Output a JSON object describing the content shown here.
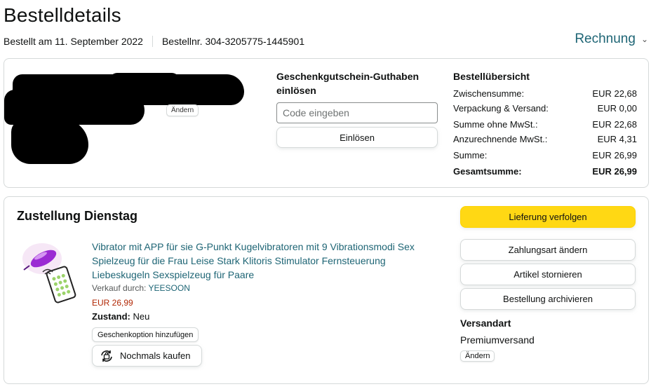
{
  "page": {
    "title": "Bestelldetails",
    "order_date": "Bestellt am 11. September 2022",
    "order_number": "Bestellnr. 304-3205775-1445901",
    "invoice_label": "Rechnung"
  },
  "address_section": {
    "change_label": "Ändern"
  },
  "gift_card": {
    "title": "Geschenkgutschein-Guthaben einlösen",
    "placeholder": "Code eingeben",
    "redeem_label": "Einlösen"
  },
  "summary": {
    "title": "Bestellübersicht",
    "rows": [
      {
        "label": "Zwischensumme:",
        "value": "EUR 22,68"
      },
      {
        "label": "Verpackung & Versand:",
        "value": "EUR 0,00"
      },
      {
        "label": "Summe ohne MwSt.:",
        "value": "EUR 22,68"
      },
      {
        "label": "Anzurechnende MwSt.:",
        "value": "EUR 4,31"
      },
      {
        "label": "Summe:",
        "value": "EUR 26,99"
      }
    ],
    "total_label": "Gesamtsumme:",
    "total_value": "EUR 26,99"
  },
  "delivery": {
    "title": "Zustellung Dienstag",
    "product": {
      "title": "Vibrator mit APP für sie G-Punkt Kugelvibratoren mit 9 Vibrationsmodi Sex Spielzeug für die Frau Leise Stark Klitoris Stimulator Fernsteuerung Liebeskugeln Sexspielzeug für Paare",
      "seller_prefix": "Verkauf durch:",
      "seller_name": "YEESOON",
      "price": "EUR 26,99",
      "condition_label": "Zustand:",
      "condition_value": "Neu",
      "gift_option_label": "Geschenkoption hinzufügen",
      "buy_again_label": "Nochmals kaufen"
    },
    "actions": {
      "track": "Lieferung verfolgen",
      "change_payment": "Zahlungsart ändern",
      "cancel_items": "Artikel stornieren",
      "archive_order": "Bestellung archivieren"
    },
    "shipping": {
      "heading": "Versandart",
      "value": "Premiumversand",
      "change_label": "Ändern"
    }
  },
  "colors": {
    "link": "#1e6575",
    "price": "#b12704",
    "primary_button": "#ffd814",
    "border": "#d5d9d9"
  }
}
